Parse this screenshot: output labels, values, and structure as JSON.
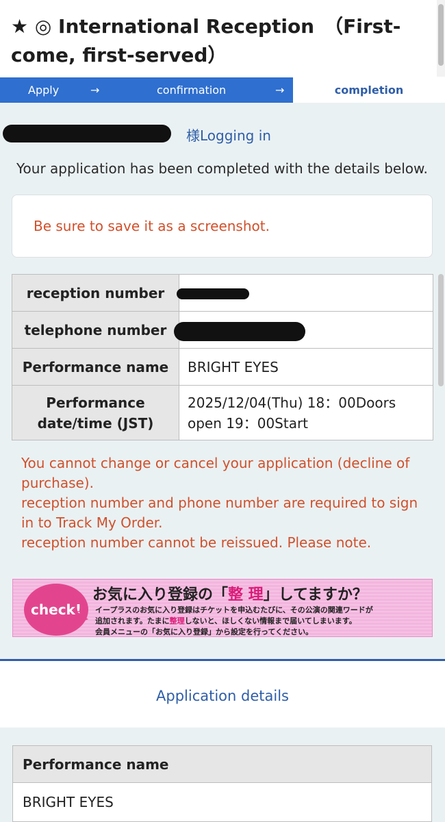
{
  "header": {
    "title": "★ ◎ International Reception　（First-come, first-served）"
  },
  "steps": {
    "apply": "Apply",
    "arrow": "→",
    "confirmation": "confirmation",
    "completion": "completion"
  },
  "login": {
    "label": "様Logging in"
  },
  "completion_message": "Your application has been completed with the details below.",
  "notice": "Be sure to save it as a screenshot.",
  "info_table": {
    "reception_label": "reception number",
    "telephone_label": "telephone number",
    "performance_label": "Performance name",
    "performance_value": "BRIGHT EYES",
    "datetime_label": "Performance date/time (JST)",
    "datetime_value": "2025/12/04(Thu) 18：00Doors open 19：00Start"
  },
  "warnings": {
    "line1": "You cannot change or cancel your application (decline of purchase).",
    "line2": "reception number and phone number are required to sign in to Track My Order.",
    "line3": "reception number cannot be reissued. Please note."
  },
  "banner": {
    "badge": "check!",
    "title_pre": "お気に入り登録の「",
    "title_hl": "整 理",
    "title_post": "」してますか？",
    "line1": "イープラスのお気に入り登録はチケットを申込むたびに、その公演の関連ワードが",
    "line2_pre": "追加されます。たまに",
    "line2_hl": "整理",
    "line2_post": "しないと、ほしくない情報まで届いてしまいます。",
    "line3": "会員メニューの「お気に入り登録」から設定を行ってください。"
  },
  "application_details": {
    "heading": "Application details",
    "performance_label": "Performance name",
    "performance_value": "BRIGHT EYES"
  },
  "colors": {
    "accent_blue": "#2f6fcf",
    "link_blue": "#2f5ea8",
    "warning_red": "#d0502b",
    "background": "#eaf1f3",
    "banner_pink": "#f3b5de",
    "badge_pink": "#e2458e"
  }
}
